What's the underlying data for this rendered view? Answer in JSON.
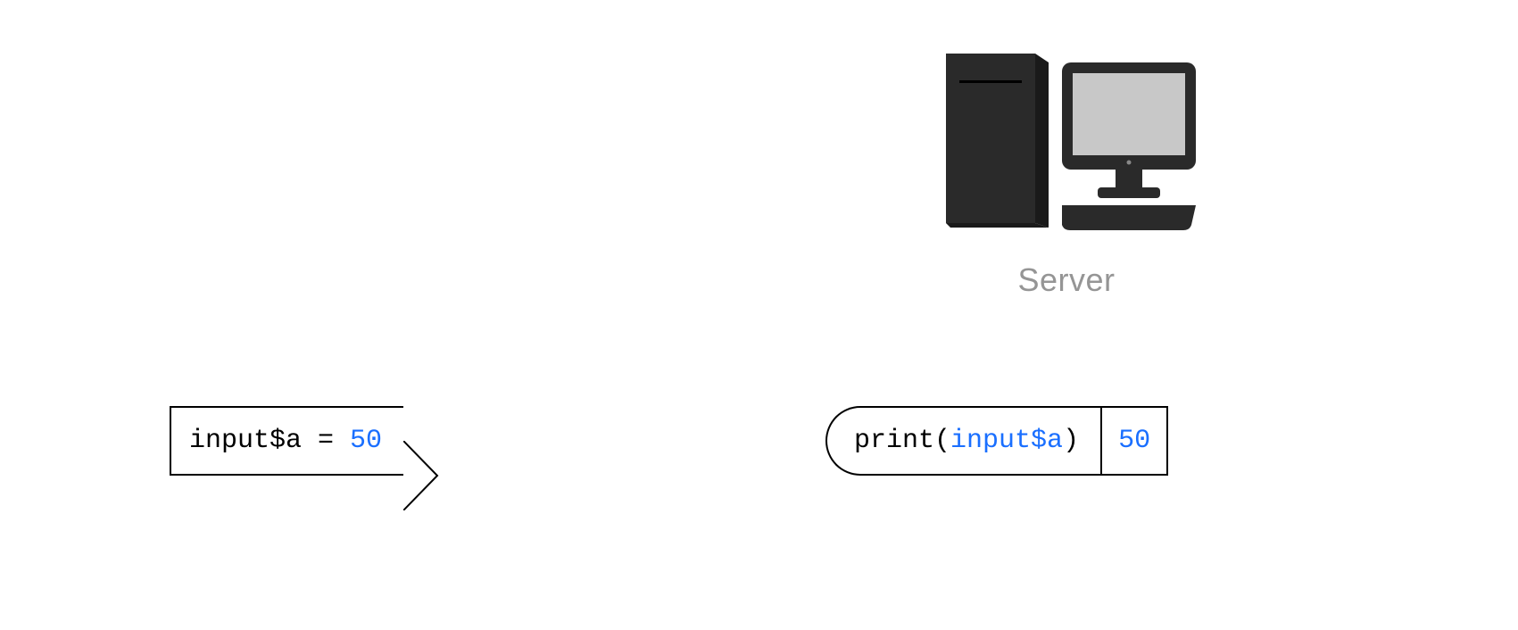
{
  "server": {
    "label": "Server"
  },
  "leftBox": {
    "prefix": "input$a = ",
    "value": "50"
  },
  "rightBox": {
    "prefix": "print(",
    "arg": "input$a",
    "suffix": ")",
    "result": "50"
  }
}
